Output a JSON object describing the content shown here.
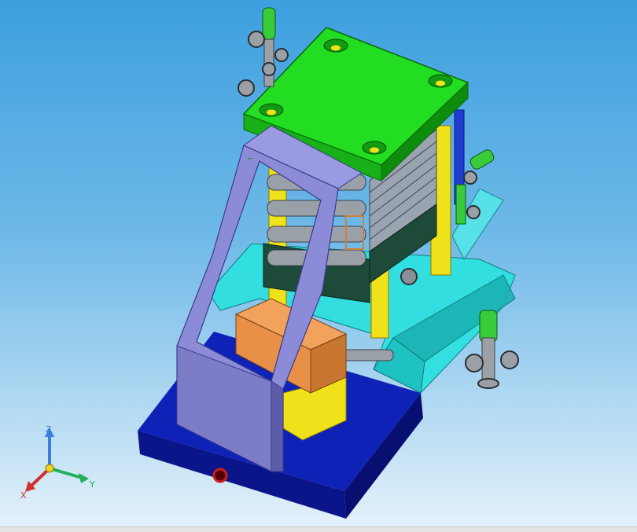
{
  "viewport": {
    "background_top": "#3d9fdf",
    "background_bottom": "#e4f1fa"
  },
  "model": {
    "parts": [
      "top-plate",
      "frame-column",
      "roller",
      "guide-rod",
      "hopper-tray",
      "gear-box",
      "base-plate",
      "valve-fitting",
      "side-frame"
    ]
  },
  "colors": {
    "top_plate": "#22dd22",
    "columns": "#f0e21a",
    "frame": "#8b8bd8",
    "tray": "#2ee0e0",
    "box": "#e89048",
    "base": "#0a1aa8",
    "valve": "#9aa0a6",
    "pipe_green": "#3acb3a"
  },
  "triad": {
    "z_label": "Z",
    "y_label": "Y",
    "x_label": "X",
    "z_color": "#3a7fd8",
    "y_color": "#22b05a",
    "x_color": "#d03030"
  }
}
